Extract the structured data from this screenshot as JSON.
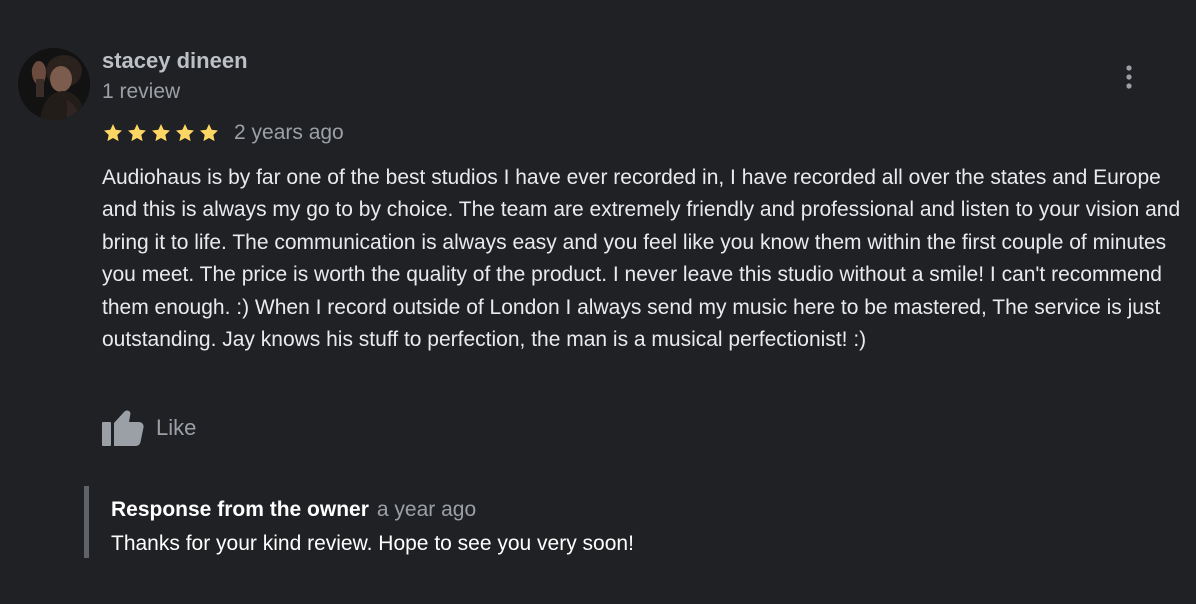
{
  "review": {
    "author_name": "stacey dineen",
    "author_meta": "1 review",
    "rating": 5,
    "rating_max": 5,
    "date": "2 years ago",
    "text": "Audiohaus is by far one of the best studios I have ever recorded in, I have recorded all over the states and Europe and this is always my go to by choice. The team are extremely friendly and professional and listen to your vision and bring it to life. The communication is always easy and you feel like you know them within the first couple of minutes you meet. The price is worth the quality of the product. I never leave this studio without a smile! I can't recommend them enough. :) When I record outside of London I always send my music here to be mastered, The service is just outstanding. Jay knows his stuff to perfection, the man is a musical perfectionist! :)",
    "like_label": "Like",
    "icons": {
      "menu": "more-vert-icon",
      "star": "star-icon",
      "like": "thumbs-up-icon"
    }
  },
  "owner_response": {
    "title": "Response from the owner",
    "date": "a year ago",
    "text": "Thanks for your kind review. Hope to see you very soon!"
  },
  "colors": {
    "background": "#202124",
    "star": "#fdd663",
    "primary_text": "#e8eaed",
    "secondary_text": "#9aa0a6",
    "response_border": "#5f6368"
  }
}
